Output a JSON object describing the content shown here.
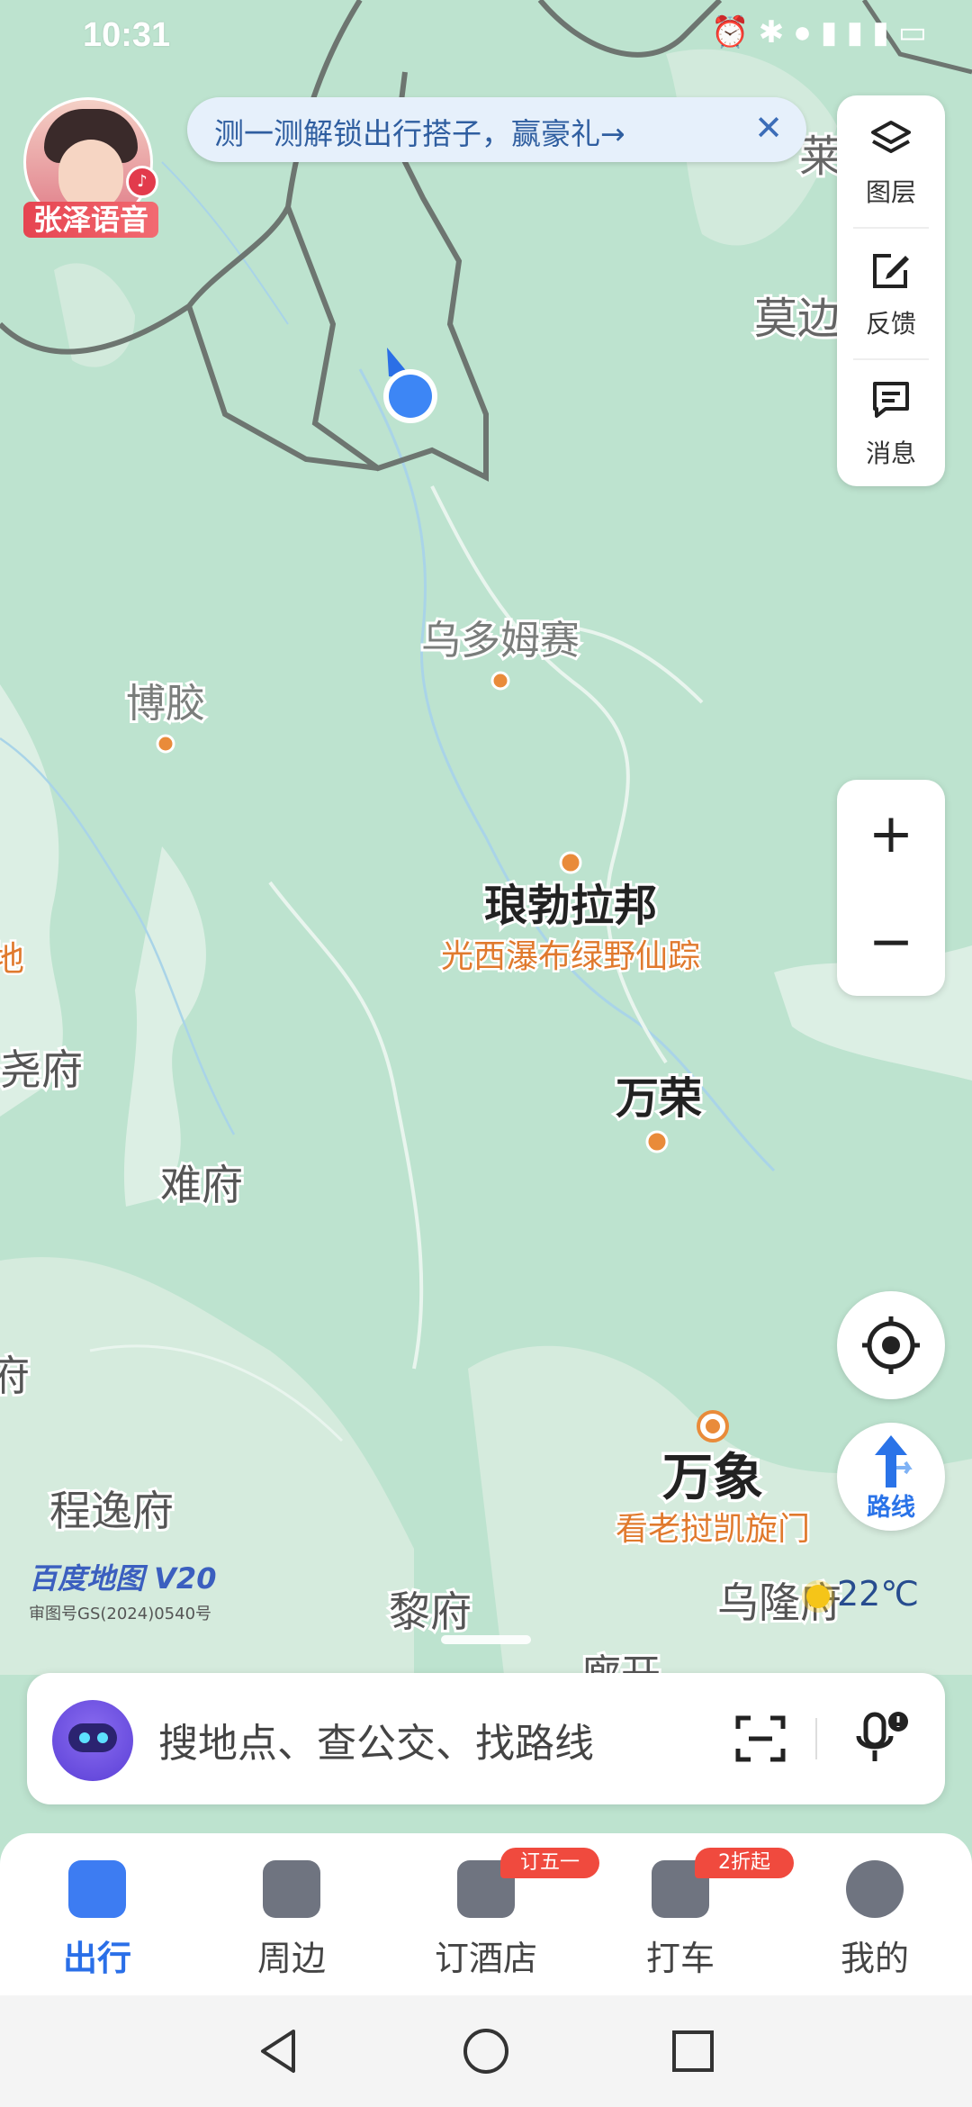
{
  "status_bar": {
    "time": "10:31",
    "icons": [
      "alarm-icon",
      "bluetooth-icon",
      "location-icon",
      "hotspot-icon",
      "signal-4g-icon",
      "signal-4g-icon",
      "battery-icon"
    ]
  },
  "voice_avatar": {
    "label": "张泽语音"
  },
  "promo_banner": {
    "text": "测一测解锁出行搭子，赢豪礼→",
    "close": "✕"
  },
  "side_panel": {
    "layers_label": "图层",
    "feedback_label": "反馈",
    "message_label": "消息"
  },
  "zoom": {
    "in": "+",
    "out": "−"
  },
  "route_button": {
    "label": "路线"
  },
  "map": {
    "places": [
      {
        "id": "wuduomusai",
        "name": "乌多姆赛"
      },
      {
        "id": "bojiao",
        "name": "博胶"
      },
      {
        "id": "luangprabang",
        "name": "琅勃拉邦",
        "poi": "光西瀑布绿野仙踪"
      },
      {
        "id": "vangvieng",
        "name": "万荣"
      },
      {
        "id": "vientiane",
        "name": "万象",
        "poi": "看老挝凯旋门"
      },
      {
        "id": "nanfu",
        "name": "难府"
      },
      {
        "id": "chengyifu",
        "name": "程逸府"
      },
      {
        "id": "lifu",
        "name": "黎府"
      },
      {
        "id": "wulongfu",
        "name": "乌隆府"
      },
      {
        "id": "yaofu",
        "name": "尧府"
      },
      {
        "id": "mobian",
        "name": "莫边"
      },
      {
        "id": "lai",
        "name": "莱"
      },
      {
        "id": "fu_left",
        "name": "府"
      },
      {
        "id": "di_left",
        "name": "地"
      },
      {
        "id": "nongkhai",
        "name": "廊开"
      }
    ],
    "logo": "百度地图",
    "logo_version": "V20",
    "approval": "审图号GS(2024)0540号",
    "weather": "22℃"
  },
  "search": {
    "placeholder": "搜地点、查公交、找路线"
  },
  "tabs": [
    {
      "label": "出行",
      "icon": "travel-icon",
      "active": true
    },
    {
      "label": "周边",
      "icon": "nearby-icon"
    },
    {
      "label": "订酒店",
      "icon": "hotel-icon",
      "badge": "订五一"
    },
    {
      "label": "打车",
      "icon": "taxi-icon",
      "badge": "2折起"
    },
    {
      "label": "我的",
      "icon": "profile-icon"
    }
  ],
  "colors": {
    "map_bg": "#bde3cf",
    "accent": "#2a6fe8",
    "poi_orange": "#e07a2e",
    "badge_red": "#f04a3e"
  }
}
